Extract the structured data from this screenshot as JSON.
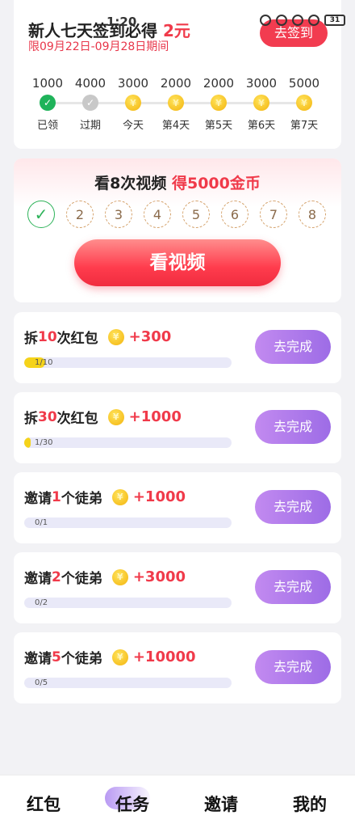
{
  "status_bar": {
    "time": "1:20",
    "battery": "31"
  },
  "signin": {
    "title_prefix": "新人七天签到必得",
    "title_amount": "2元",
    "period": "限09月22日-09月28日期间",
    "button_label": "去签到",
    "days": [
      {
        "value": "1000",
        "label": "已领",
        "state": "done"
      },
      {
        "value": "4000",
        "label": "过期",
        "state": "expired"
      },
      {
        "value": "3000",
        "label": "今天",
        "state": "coin"
      },
      {
        "value": "2000",
        "label": "第4天",
        "state": "coin"
      },
      {
        "value": "2000",
        "label": "第5天",
        "state": "coin"
      },
      {
        "value": "3000",
        "label": "第6天",
        "state": "coin"
      },
      {
        "value": "5000",
        "label": "第7天",
        "state": "coin"
      }
    ]
  },
  "watch": {
    "title_prefix": "看8次视频",
    "title_reward": "得5000金币",
    "check_glyph": "✓",
    "steps": [
      "2",
      "3",
      "4",
      "5",
      "6",
      "7",
      "8"
    ],
    "button_label": "看视频"
  },
  "coin_glyph": "¥",
  "tasks": [
    {
      "prefix": "拆",
      "num": "10",
      "suffix": "次红包",
      "reward": "+300",
      "progress_text": "1/10",
      "progress": 0.1,
      "button": "去完成"
    },
    {
      "prefix": "拆",
      "num": "30",
      "suffix": "次红包",
      "reward": "+1000",
      "progress_text": "1/30",
      "progress": 0.033,
      "button": "去完成"
    },
    {
      "prefix": "邀请",
      "num": "1",
      "suffix": "个徒弟",
      "reward": "+1000",
      "progress_text": "0/1",
      "progress": 0,
      "button": "去完成"
    },
    {
      "prefix": "邀请",
      "num": "2",
      "suffix": "个徒弟",
      "reward": "+3000",
      "progress_text": "0/2",
      "progress": 0,
      "button": "去完成"
    },
    {
      "prefix": "邀请",
      "num": "5",
      "suffix": "个徒弟",
      "reward": "+10000",
      "progress_text": "0/5",
      "progress": 0,
      "button": "去完成"
    }
  ],
  "bottom_nav": [
    {
      "label": "红包"
    },
    {
      "label": "任务",
      "active": true
    },
    {
      "label": "邀请"
    },
    {
      "label": "我的"
    }
  ],
  "colors": {
    "accent_red": "#f03a4a",
    "task_button": "#9d6ce6",
    "progress_fill": "#f5d31a",
    "done_green": "#1fb35a"
  }
}
